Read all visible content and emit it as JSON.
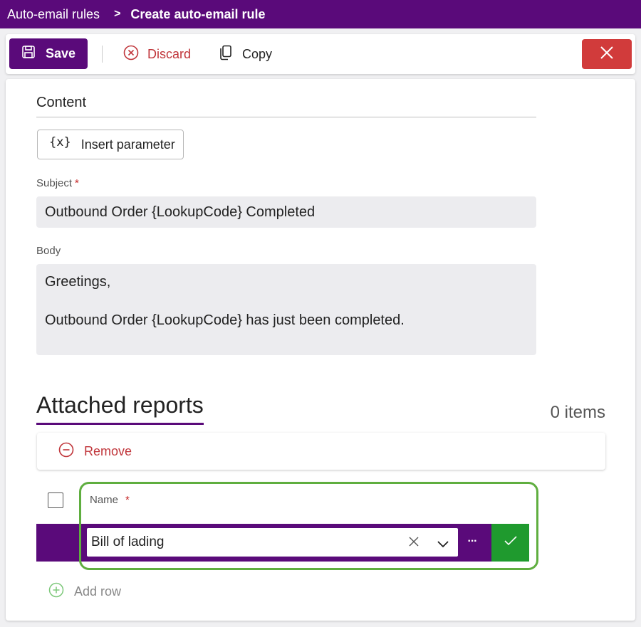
{
  "breadcrumb": {
    "parent": "Auto-email rules",
    "separator": ">",
    "current": "Create auto-email rule"
  },
  "toolbar": {
    "save_label": "Save",
    "discard_label": "Discard",
    "copy_label": "Copy"
  },
  "content": {
    "section_title": "Content",
    "insert_parameter_icon": "{x}",
    "insert_parameter_label": "Insert parameter",
    "subject_label": "Subject",
    "required_marker": "*",
    "subject_value": "Outbound Order {LookupCode} Completed",
    "body_label": "Body",
    "body_lines": [
      "Greetings,",
      "Outbound Order {LookupCode} has just been completed."
    ]
  },
  "attached_reports": {
    "title": "Attached reports",
    "count_label": "0 items",
    "remove_label": "Remove",
    "name_column_label": "Name",
    "name_required_marker": "*",
    "name_value": "Bill of lading",
    "more_label": "···",
    "add_row_label": "Add row"
  },
  "colors": {
    "brand_purple": "#5a0a7a",
    "danger_red": "#d13b3b",
    "success_green": "#1f9a2e",
    "highlight_green": "#5fae3f",
    "field_background": "#ececef"
  },
  "icons": {
    "save": "save-icon",
    "discard": "discard-circle-x-icon",
    "copy": "copy-icon",
    "close": "close-icon",
    "remove": "remove-circle-minus-icon",
    "clear": "clear-x-icon",
    "dropdown": "chevron-down-icon",
    "confirm": "checkmark-icon",
    "add_row": "add-circle-plus-icon"
  }
}
